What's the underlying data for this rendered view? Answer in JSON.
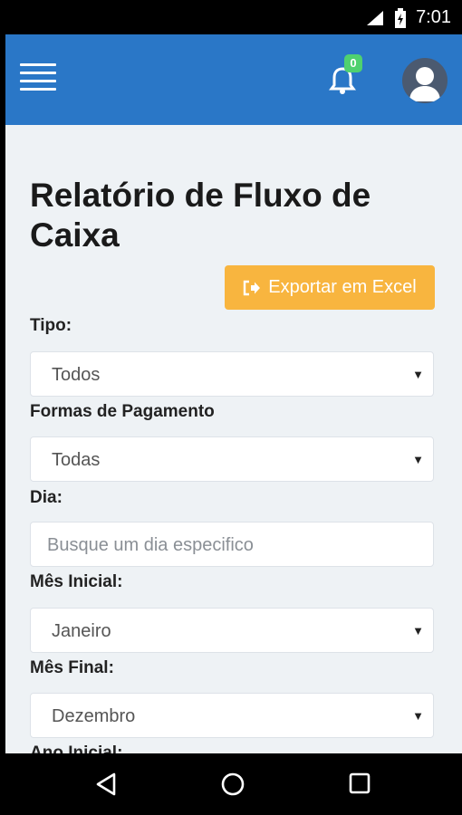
{
  "status": {
    "time": "7:01",
    "signal_icon": "signal-icon",
    "battery_icon": "battery-icon"
  },
  "appbar": {
    "menu_icon": "menu-icon",
    "notification_count": "0",
    "bell_icon": "bell-icon",
    "avatar_icon": "avatar-icon"
  },
  "page": {
    "title": "Relatório de Fluxo de Caixa",
    "export_label": "Exportar em Excel",
    "export_icon": "sign-out-icon"
  },
  "form": {
    "tipo_label": "Tipo:",
    "tipo_value": "Todos",
    "formas_label": "Formas de Pagamento",
    "formas_value": "Todas",
    "dia_label": "Dia:",
    "dia_placeholder": "Busque um dia especifico",
    "mes_inicial_label": "Mês Inicial:",
    "mes_inicial_value": "Janeiro",
    "mes_final_label": "Mês Final:",
    "mes_final_value": "Dezembro",
    "ano_inicial_label": "Ano Inicial:"
  },
  "colors": {
    "appbar": "#2a77c7",
    "export_button": "#f8b53f",
    "badge": "#4fd16f",
    "background": "#eef2f5"
  }
}
